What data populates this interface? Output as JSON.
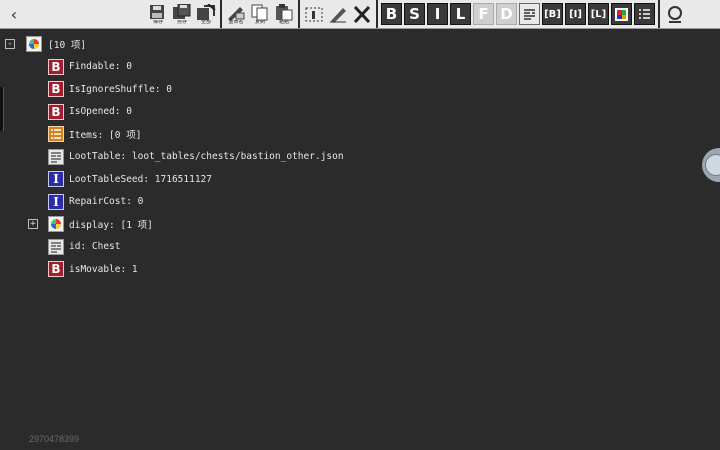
{
  "toolbar": {
    "file_buttons": [
      {
        "name": "save",
        "label": "保存"
      },
      {
        "name": "save-as",
        "label": "另存"
      },
      {
        "name": "save-all",
        "label": "全部"
      }
    ],
    "edit_buttons": [
      {
        "name": "rename",
        "label": "重命名"
      },
      {
        "name": "copy",
        "label": "复制"
      },
      {
        "name": "paste",
        "label": "粘贴"
      }
    ],
    "tool_buttons": [
      {
        "name": "select",
        "label": ""
      },
      {
        "name": "edit",
        "label": ""
      },
      {
        "name": "delete",
        "label": ""
      }
    ],
    "type_buttons": [
      {
        "name": "byte",
        "text": "B",
        "disabled": false
      },
      {
        "name": "short",
        "text": "S",
        "disabled": false
      },
      {
        "name": "int",
        "text": "I",
        "disabled": false
      },
      {
        "name": "long",
        "text": "L",
        "disabled": false
      },
      {
        "name": "float",
        "text": "F",
        "disabled": true
      },
      {
        "name": "double",
        "text": "D",
        "disabled": true
      },
      {
        "name": "string",
        "text": "",
        "disabled": false
      },
      {
        "name": "byte-array",
        "text": "[B]",
        "disabled": false
      },
      {
        "name": "int-array",
        "text": "[I]",
        "disabled": false
      },
      {
        "name": "long-array",
        "text": "[L]",
        "disabled": false
      },
      {
        "name": "compound",
        "text": "",
        "disabled": false
      },
      {
        "name": "list",
        "text": "",
        "disabled": false
      }
    ]
  },
  "tree": {
    "root": {
      "label": "[10 项]",
      "expander": "-"
    },
    "items": [
      {
        "type": "byte",
        "icon_text": "B",
        "label": "Findable: 0"
      },
      {
        "type": "byte",
        "icon_text": "B",
        "label": "IsIgnoreShuffle: 0"
      },
      {
        "type": "byte",
        "icon_text": "B",
        "label": "IsOpened: 0"
      },
      {
        "type": "list",
        "icon_text": "",
        "label": "Items: [0 项]"
      },
      {
        "type": "string",
        "icon_text": "",
        "label": "LootTable: loot_tables/chests/bastion_other.json"
      },
      {
        "type": "int",
        "icon_text": "I",
        "label": "LootTableSeed: 1716511127"
      },
      {
        "type": "int",
        "icon_text": "I",
        "label": "RepairCost: 0"
      },
      {
        "type": "compound",
        "icon_text": "",
        "label": "display: [1 项]",
        "expander": "+"
      },
      {
        "type": "string",
        "icon_text": "",
        "label": "id: Chest"
      },
      {
        "type": "byte",
        "icon_text": "B",
        "label": "isMovable: 1"
      }
    ]
  },
  "footer": {
    "id": "2970478399"
  },
  "colors": {
    "background": "#2b2b2b",
    "toolbar": "#e9e9e9",
    "byte_icon": "#a31e2c",
    "int_icon": "#2c2ca8",
    "list_icon": "#d8801a"
  }
}
